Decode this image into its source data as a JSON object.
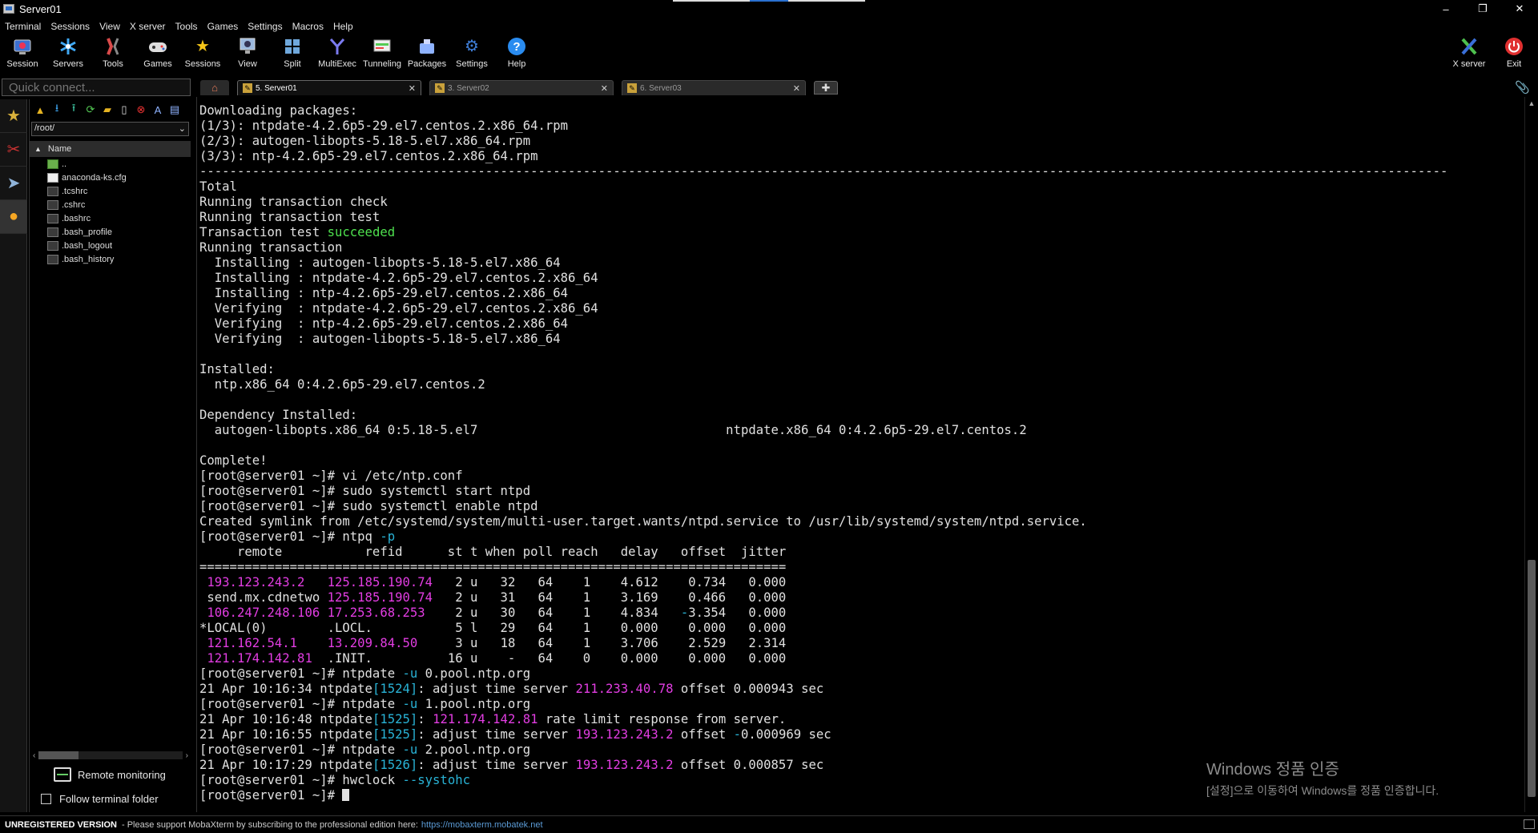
{
  "window": {
    "title": "Server01",
    "controls": [
      "–",
      "❐",
      "✕"
    ]
  },
  "menu": [
    "Terminal",
    "Sessions",
    "View",
    "X server",
    "Tools",
    "Games",
    "Settings",
    "Macros",
    "Help"
  ],
  "toolbar": {
    "buttons": [
      {
        "label": "Session",
        "icon": "session-icon",
        "color": "#4a90d9"
      },
      {
        "label": "Servers",
        "icon": "servers-icon",
        "color": "#3fa9f5"
      },
      {
        "label": "Tools",
        "icon": "tools-icon",
        "color": "#d94a4a"
      },
      {
        "label": "Games",
        "icon": "games-icon",
        "color": "#cfcfcf"
      },
      {
        "label": "Sessions",
        "icon": "star-icon",
        "color": "#f5c518"
      },
      {
        "label": "View",
        "icon": "view-icon",
        "color": "#8fb3d9"
      },
      {
        "label": "Split",
        "icon": "split-icon",
        "color": "#6fa8dc"
      },
      {
        "label": "MultiExec",
        "icon": "multiexec-icon",
        "color": "#7b7bf0"
      },
      {
        "label": "Tunneling",
        "icon": "tunneling-icon",
        "color": "#66cc66"
      },
      {
        "label": "Packages",
        "icon": "packages-icon",
        "color": "#8fb3ff"
      },
      {
        "label": "Settings",
        "icon": "settings-icon",
        "color": "#3f7fd9"
      },
      {
        "label": "Help",
        "icon": "help-icon",
        "color": "#2a8cf0"
      }
    ],
    "right_buttons": [
      {
        "label": "X server",
        "icon": "x-server-icon",
        "color": "#4ec04e"
      },
      {
        "label": "Exit",
        "icon": "power-icon",
        "color": "#e03030"
      }
    ]
  },
  "quick_connect": {
    "placeholder": "Quick connect..."
  },
  "sftp": {
    "path": "/root/",
    "column": "Name",
    "files": [
      "..",
      "anaconda-ks.cfg",
      ".tcshrc",
      ".cshrc",
      ".bashrc",
      ".bash_profile",
      ".bash_logout",
      ".bash_history"
    ],
    "remote_monitoring": "Remote monitoring",
    "follow_terminal": "Follow terminal folder"
  },
  "tabs": [
    {
      "label": "5. Server01",
      "active": true
    },
    {
      "label": "3. Server02",
      "active": false
    },
    {
      "label": "6. Server03",
      "active": false
    }
  ],
  "terminal": {
    "lines": [
      [
        {
          "t": "Downloading packages:"
        }
      ],
      [
        {
          "t": "(1/3): ntpdate-4.2.6p5-29.el7.centos.2.x86_64.rpm"
        }
      ],
      [
        {
          "t": "(2/3): autogen-libopts-5.18-5.el7.x86_64.rpm"
        }
      ],
      [
        {
          "t": "(3/3): ntp-4.2.6p5-29.el7.centos.2.x86_64.rpm"
        }
      ],
      [
        {
          "t": "----------------------------------------------------------------------------------------------------------------------------------------------------------------------"
        }
      ],
      [
        {
          "t": "Total"
        }
      ],
      [
        {
          "t": "Running transaction check"
        }
      ],
      [
        {
          "t": "Running transaction test"
        }
      ],
      [
        {
          "t": "Transaction test "
        },
        {
          "t": "succeeded",
          "c": "green"
        }
      ],
      [
        {
          "t": "Running transaction"
        }
      ],
      [
        {
          "t": "  Installing : autogen-libopts-5.18-5.el7.x86_64"
        }
      ],
      [
        {
          "t": "  Installing : ntpdate-4.2.6p5-29.el7.centos.2.x86_64"
        }
      ],
      [
        {
          "t": "  Installing : ntp-4.2.6p5-29.el7.centos.2.x86_64"
        }
      ],
      [
        {
          "t": "  Verifying  : ntpdate-4.2.6p5-29.el7.centos.2.x86_64"
        }
      ],
      [
        {
          "t": "  Verifying  : ntp-4.2.6p5-29.el7.centos.2.x86_64"
        }
      ],
      [
        {
          "t": "  Verifying  : autogen-libopts-5.18-5.el7.x86_64"
        }
      ],
      [
        {
          "t": ""
        }
      ],
      [
        {
          "t": "Installed:"
        }
      ],
      [
        {
          "t": "  ntp.x86_64 0:4.2.6p5-29.el7.centos.2"
        }
      ],
      [
        {
          "t": ""
        }
      ],
      [
        {
          "t": "Dependency Installed:"
        }
      ],
      [
        {
          "t": "  autogen-libopts.x86_64 0:5.18-5.el7                                 ntpdate.x86_64 0:4.2.6p5-29.el7.centos.2"
        }
      ],
      [
        {
          "t": ""
        }
      ],
      [
        {
          "t": "Complete!"
        }
      ],
      [
        {
          "t": "[root@server01 ~]# vi /etc/ntp.conf"
        }
      ],
      [
        {
          "t": "[root@server01 ~]# sudo systemctl start ntpd"
        }
      ],
      [
        {
          "t": "[root@server01 ~]# sudo systemctl enable ntpd"
        }
      ],
      [
        {
          "t": "Created symlink from /etc/systemd/system/multi-user.target.wants/ntpd.service to /usr/lib/systemd/system/ntpd.service."
        }
      ],
      [
        {
          "t": "[root@server01 ~]# ntpq "
        },
        {
          "t": "-p",
          "c": "cyan"
        }
      ],
      [
        {
          "t": "     remote           refid      st t when poll reach   delay   offset  jitter"
        }
      ],
      [
        {
          "t": "=============================================================================="
        }
      ],
      [
        {
          "t": " "
        },
        {
          "t": "193.123.243.2",
          "c": "mag"
        },
        {
          "t": "   "
        },
        {
          "t": "125.185.190.74",
          "c": "mag"
        },
        {
          "t": "   2 u   32   64    1    4.612    0.734   0.000"
        }
      ],
      [
        {
          "t": " send.mx.cdnetwo "
        },
        {
          "t": "125.185.190.74",
          "c": "mag"
        },
        {
          "t": "   2 u   31   64    1    3.169    0.466   0.000"
        }
      ],
      [
        {
          "t": " "
        },
        {
          "t": "106.247.248.106",
          "c": "mag"
        },
        {
          "t": " "
        },
        {
          "t": "17.253.68.253",
          "c": "mag"
        },
        {
          "t": "    2 u   30   64    1    4.834   "
        },
        {
          "t": "-",
          "c": "cyan"
        },
        {
          "t": "3.354   0.000"
        }
      ],
      [
        {
          "t": "*LOCAL(0)        .LOCL.           5 l   29   64    1    0.000    0.000   0.000"
        }
      ],
      [
        {
          "t": " "
        },
        {
          "t": "121.162.54.1",
          "c": "mag"
        },
        {
          "t": "    "
        },
        {
          "t": "13.209.84.50",
          "c": "mag"
        },
        {
          "t": "     3 u   18   64    1    3.706    2.529   2.314"
        }
      ],
      [
        {
          "t": " "
        },
        {
          "t": "121.174.142.81",
          "c": "mag"
        },
        {
          "t": "  .INIT.          16 u    -   64    0    0.000    0.000   0.000"
        }
      ],
      [
        {
          "t": "[root@server01 ~]# ntpdate "
        },
        {
          "t": "-u",
          "c": "cyan"
        },
        {
          "t": " 0.pool.ntp.org"
        }
      ],
      [
        {
          "t": "21 Apr 10:16:34 ntpdate"
        },
        {
          "t": "[1524]",
          "c": "cyan"
        },
        {
          "t": ": adjust time server "
        },
        {
          "t": "211.233.40.78",
          "c": "mag"
        },
        {
          "t": " offset 0.000943 sec"
        }
      ],
      [
        {
          "t": "[root@server01 ~]# ntpdate "
        },
        {
          "t": "-u",
          "c": "cyan"
        },
        {
          "t": " 1.pool.ntp.org"
        }
      ],
      [
        {
          "t": "21 Apr 10:16:48 ntpdate"
        },
        {
          "t": "[1525]",
          "c": "cyan"
        },
        {
          "t": ": "
        },
        {
          "t": "121.174.142.81",
          "c": "mag"
        },
        {
          "t": " rate limit response from server."
        }
      ],
      [
        {
          "t": "21 Apr 10:16:55 ntpdate"
        },
        {
          "t": "[1525]",
          "c": "cyan"
        },
        {
          "t": ": adjust time server "
        },
        {
          "t": "193.123.243.2",
          "c": "mag"
        },
        {
          "t": " offset "
        },
        {
          "t": "-",
          "c": "cyan"
        },
        {
          "t": "0.000969 sec"
        }
      ],
      [
        {
          "t": "[root@server01 ~]# ntpdate "
        },
        {
          "t": "-u",
          "c": "cyan"
        },
        {
          "t": " 2.pool.ntp.org"
        }
      ],
      [
        {
          "t": "21 Apr 10:17:29 ntpdate"
        },
        {
          "t": "[1526]",
          "c": "cyan"
        },
        {
          "t": ": adjust time server "
        },
        {
          "t": "193.123.243.2",
          "c": "mag"
        },
        {
          "t": " offset 0.000857 sec"
        }
      ],
      [
        {
          "t": "[root@server01 ~]# hwclock "
        },
        {
          "t": "--systohc",
          "c": "cyan"
        }
      ],
      [
        {
          "t": "[root@server01 ~]# "
        },
        {
          "t": "",
          "c": "cursor"
        }
      ]
    ]
  },
  "watermark": {
    "title": "Windows 정품 인증",
    "subtitle": "[설정]으로 이동하여 Windows를 정품 인증합니다."
  },
  "statusbar": {
    "unregistered": "UNREGISTERED VERSION",
    "message": " -  Please support MobaXterm by subscribing to the professional edition here:",
    "link": "https://mobaxterm.mobatek.net"
  }
}
